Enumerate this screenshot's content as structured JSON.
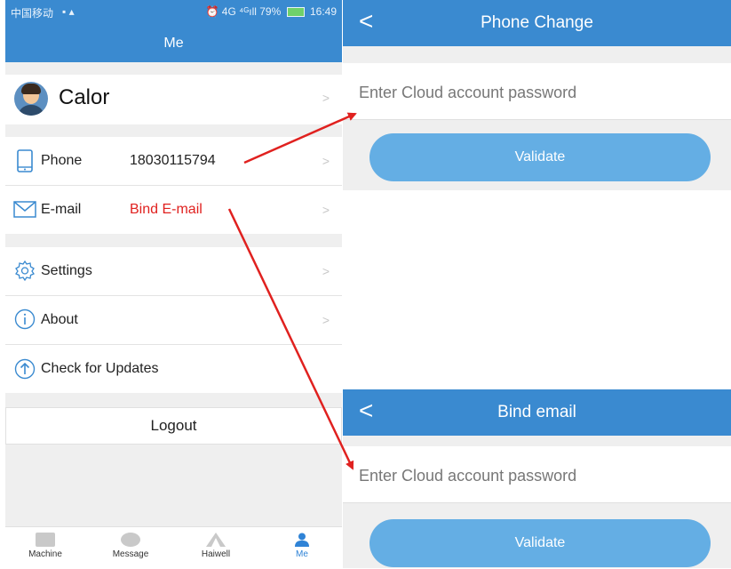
{
  "status_bar": {
    "carrier": "中国移动",
    "indicators": "⏰ 4G ⁴ᴳıll 79%",
    "time": "16:49"
  },
  "header": {
    "title": "Me"
  },
  "profile": {
    "name": "Calor"
  },
  "contact": {
    "phone_label": "Phone",
    "phone_value": "18030115794",
    "email_label": "E-mail",
    "email_value": "Bind E-mail"
  },
  "menu": {
    "settings": "Settings",
    "about": "About",
    "updates": "Check for Updates"
  },
  "logout_label": "Logout",
  "tabbar": {
    "items": [
      {
        "label": "Machine"
      },
      {
        "label": "Message"
      },
      {
        "label": "Haiwell"
      },
      {
        "label": "Me"
      }
    ]
  },
  "phone_change": {
    "title": "Phone Change",
    "placeholder": "Enter Cloud account password",
    "validate_label": "Validate"
  },
  "bind_email": {
    "title": "Bind email",
    "placeholder": "Enter Cloud account password",
    "validate_label": "Validate"
  },
  "icons": {
    "back": "chevron-left-icon",
    "chevron": "chevron-right-icon"
  },
  "colors": {
    "header_blue": "#3a8ad0",
    "button_blue": "#64aee4",
    "accent_red": "#e0211f",
    "tab_active": "#2f83d6"
  }
}
